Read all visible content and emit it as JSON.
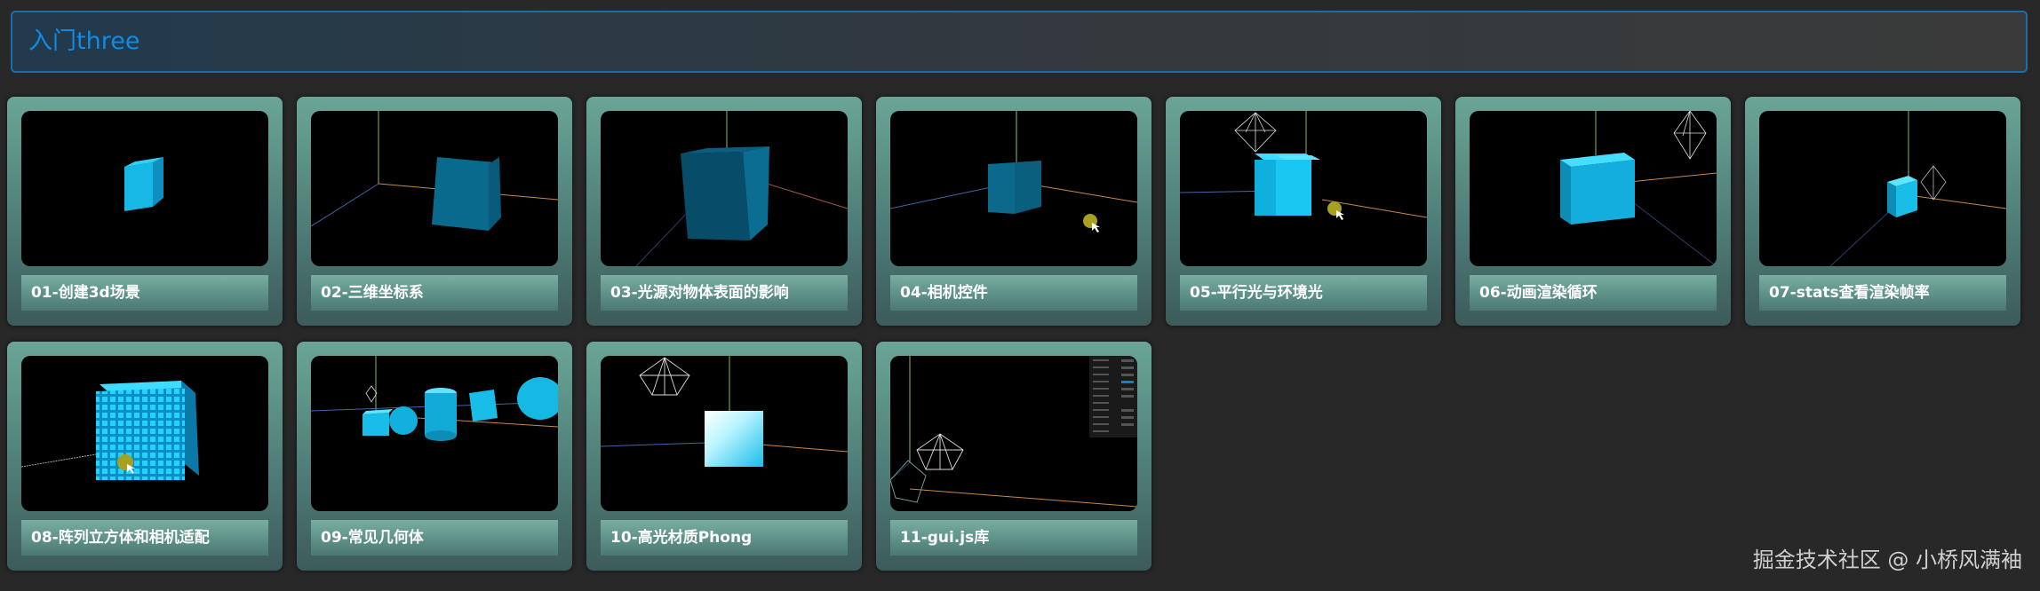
{
  "header": {
    "title": "入门three"
  },
  "cards": [
    {
      "label": "01-创建3d场景"
    },
    {
      "label": "02-三维坐标系"
    },
    {
      "label": "03-光源对物体表面的影响"
    },
    {
      "label": "04-相机控件"
    },
    {
      "label": "05-平行光与环境光"
    },
    {
      "label": "06-动画渲染循环"
    },
    {
      "label": "07-stats查看渲染帧率"
    },
    {
      "label": "08-阵列立方体和相机适配"
    },
    {
      "label": "09-常见几何体"
    },
    {
      "label": "10-高光材质Phong"
    },
    {
      "label": "11-gui.js库"
    }
  ],
  "watermark": "掘金技术社区 @ 小桥风满袖",
  "colors": {
    "accent": "#0f8be6",
    "card": "#5b8e85",
    "cube": "#1cc8f0"
  }
}
